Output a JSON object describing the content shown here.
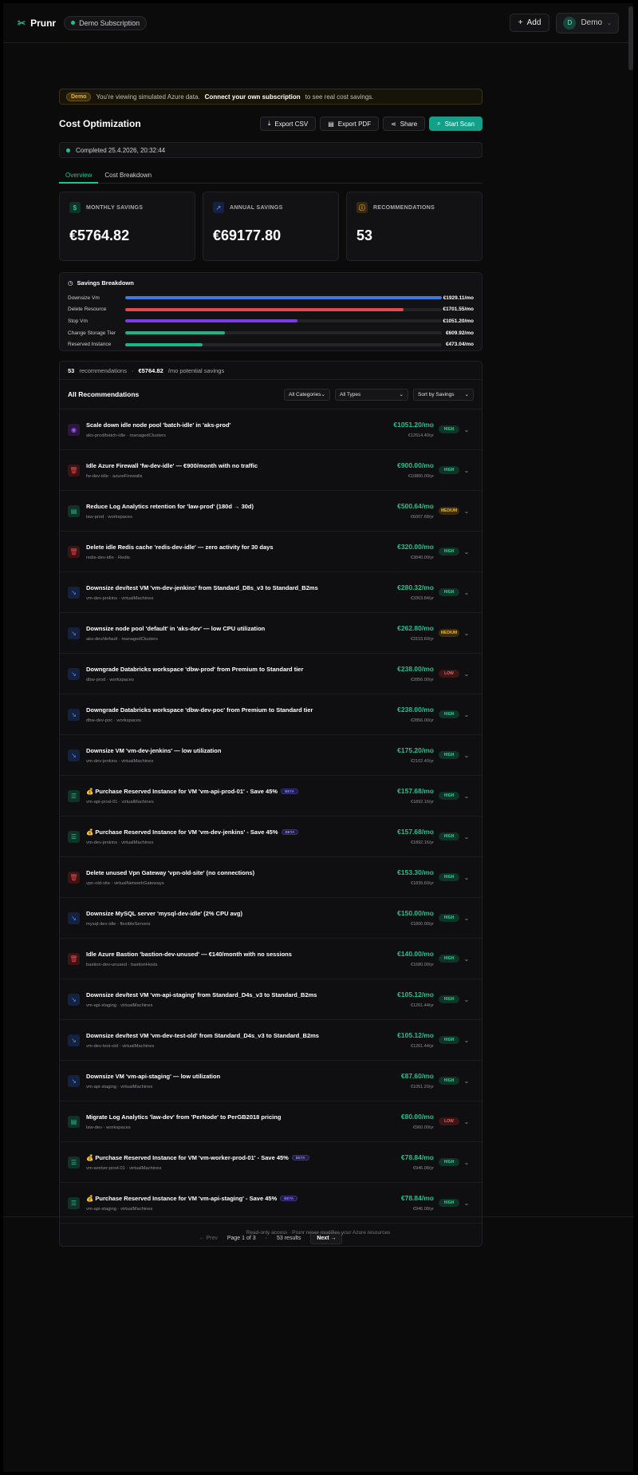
{
  "header": {
    "brand": "Prunr",
    "subscription": "Demo Subscription",
    "add_label": "Add",
    "user_initial": "D",
    "user_label": "Demo"
  },
  "banner": {
    "tag": "Demo",
    "text": "You're viewing simulated Azure data.",
    "link": "Connect your own subscription",
    "suffix": "to see real cost savings."
  },
  "page": {
    "title": "Cost Optimization",
    "actions": {
      "export_csv": "Export CSV",
      "export_pdf": "Export PDF",
      "share": "Share",
      "start_scan": "Start Scan"
    },
    "completed": "Completed 25.4.2026, 20:32:44",
    "tabs": [
      "Overview",
      "Cost Breakdown"
    ]
  },
  "stats": [
    {
      "label": "MONTHLY SAVINGS",
      "value": "€5764.82",
      "icon": "dollar-icon",
      "color": "#22c28a"
    },
    {
      "label": "ANNUAL SAVINGS",
      "value": "€69177.80",
      "icon": "trend-up-icon",
      "color": "#4f7de8"
    },
    {
      "label": "RECOMMENDATIONS",
      "value": "53",
      "icon": "alert-icon",
      "color": "#e79a2f"
    }
  ],
  "breakdown": {
    "title": "Savings Breakdown",
    "rows": [
      {
        "label": "Downsize Vm",
        "amount": "€1929.11/mo",
        "fraction": 1.0,
        "color": "#3b7ae6"
      },
      {
        "label": "Delete Resource",
        "amount": "€1701.55/mo",
        "fraction": 0.88,
        "color": "#e5484d"
      },
      {
        "label": "Stop Vm",
        "amount": "€1051.20/mo",
        "fraction": 0.545,
        "color": "#7c3aed"
      },
      {
        "label": "Change Storage Tier",
        "amount": "€609.92/mo",
        "fraction": 0.316,
        "color": "#1bb482"
      },
      {
        "label": "Reserved Instance",
        "amount": "€473.04/mo",
        "fraction": 0.245,
        "color": "#1bb482"
      }
    ]
  },
  "recommendations": {
    "count": "53",
    "count_label": "recommendations",
    "total": "€5764.82",
    "total_label": "/mo potential savings",
    "title": "All Recommendations",
    "filters": {
      "categories": "All Categories",
      "types": "All Types",
      "sort": "Sort by Savings"
    },
    "items": [
      {
        "title": "Scale down idle node pool 'batch-idle' in 'aks-prod'",
        "sub": "aks-prod/batch-idle · managedClusters",
        "monthly": "€1051.20/mo",
        "yearly": "€12614.40/yr",
        "priority": "HIGH",
        "kind": "stop"
      },
      {
        "title": "Idle Azure Firewall 'fw-dev-idle' — €900/month with no traffic",
        "sub": "fw-dev-idle · azureFirewalls",
        "monthly": "€900.00/mo",
        "yearly": "€10800.00/yr",
        "priority": "HIGH",
        "kind": "delete"
      },
      {
        "title": "Reduce Log Analytics retention for 'law-prod' (180d → 30d)",
        "sub": "law-prod · workspaces",
        "monthly": "€500.64/mo",
        "yearly": "€6007.68/yr",
        "priority": "MEDIUM",
        "kind": "storage"
      },
      {
        "title": "Delete idle Redis cache 'redis-dev-idle' — zero activity for 30 days",
        "sub": "redis-dev-idle · Redis",
        "monthly": "€320.00/mo",
        "yearly": "€3840.00/yr",
        "priority": "HIGH",
        "kind": "delete"
      },
      {
        "title": "Downsize dev/test VM 'vm-dev-jenkins' from Standard_D8s_v3 to Standard_B2ms",
        "sub": "vm-dev-jenkins · virtualMachines",
        "monthly": "€280.32/mo",
        "yearly": "€3363.84/yr",
        "priority": "HIGH",
        "kind": "downsize"
      },
      {
        "title": "Downsize node pool 'default' in 'aks-dev' — low CPU utilization",
        "sub": "aks-dev/default · managedClusters",
        "monthly": "€262.80/mo",
        "yearly": "€3153.60/yr",
        "priority": "MEDIUM",
        "kind": "downsize"
      },
      {
        "title": "Downgrade Databricks workspace 'dbw-prod' from Premium to Standard tier",
        "sub": "dbw-prod · workspaces",
        "monthly": "€238.00/mo",
        "yearly": "€2856.00/yr",
        "priority": "LOW",
        "kind": "downsize"
      },
      {
        "title": "Downgrade Databricks workspace 'dbw-dev-poc' from Premium to Standard tier",
        "sub": "dbw-dev-poc · workspaces",
        "monthly": "€238.00/mo",
        "yearly": "€2856.00/yr",
        "priority": "HIGH",
        "kind": "downsize"
      },
      {
        "title": "Downsize VM 'vm-dev-jenkins' — low utilization",
        "sub": "vm-dev-jenkins · virtualMachines",
        "monthly": "€175.20/mo",
        "yearly": "€2102.40/yr",
        "priority": "HIGH",
        "kind": "downsize"
      },
      {
        "title": "💰 Purchase Reserved Instance for VM 'vm-api-prod-01' - Save 45%",
        "sub": "vm-api-prod-01 · virtualMachines",
        "monthly": "€157.68/mo",
        "yearly": "€1892.16/yr",
        "priority": "HIGH",
        "kind": "reserved",
        "beta": "BETA"
      },
      {
        "title": "💰 Purchase Reserved Instance for VM 'vm-dev-jenkins' - Save 45%",
        "sub": "vm-dev-jenkins · virtualMachines",
        "monthly": "€157.68/mo",
        "yearly": "€1892.16/yr",
        "priority": "HIGH",
        "kind": "reserved",
        "beta": "BETA"
      },
      {
        "title": "Delete unused Vpn Gateway 'vpn-old-site' (no connections)",
        "sub": "vpn-old-site · virtualNetworkGateways",
        "monthly": "€153.30/mo",
        "yearly": "€1839.60/yr",
        "priority": "HIGH",
        "kind": "delete"
      },
      {
        "title": "Downsize MySQL server 'mysql-dev-idle' (2% CPU avg)",
        "sub": "mysql-dev-idle · flexibleServers",
        "monthly": "€150.00/mo",
        "yearly": "€1800.00/yr",
        "priority": "HIGH",
        "kind": "downsize"
      },
      {
        "title": "Idle Azure Bastion 'bastion-dev-unused' — €140/month with no sessions",
        "sub": "bastion-dev-unused · bastionHosts",
        "monthly": "€140.00/mo",
        "yearly": "€1680.00/yr",
        "priority": "HIGH",
        "kind": "delete"
      },
      {
        "title": "Downsize dev/test VM 'vm-api-staging' from Standard_D4s_v3 to Standard_B2ms",
        "sub": "vm-api-staging · virtualMachines",
        "monthly": "€105.12/mo",
        "yearly": "€1261.44/yr",
        "priority": "HIGH",
        "kind": "downsize"
      },
      {
        "title": "Downsize dev/test VM 'vm-dev-test-old' from Standard_D4s_v3 to Standard_B2ms",
        "sub": "vm-dev-test-old · virtualMachines",
        "monthly": "€105.12/mo",
        "yearly": "€1261.44/yr",
        "priority": "HIGH",
        "kind": "downsize"
      },
      {
        "title": "Downsize VM 'vm-api-staging' — low utilization",
        "sub": "vm-api-staging · virtualMachines",
        "monthly": "€87.60/mo",
        "yearly": "€1051.20/yr",
        "priority": "HIGH",
        "kind": "downsize"
      },
      {
        "title": "Migrate Log Analytics 'law-dev' from 'PerNode' to PerGB2018 pricing",
        "sub": "law-dev · workspaces",
        "monthly": "€80.00/mo",
        "yearly": "€960.00/yr",
        "priority": "LOW",
        "kind": "storage"
      },
      {
        "title": "💰 Purchase Reserved Instance for VM 'vm-worker-prod-01' - Save 45%",
        "sub": "vm-worker-prod-01 · virtualMachines",
        "monthly": "€78.84/mo",
        "yearly": "€946.08/yr",
        "priority": "HIGH",
        "kind": "reserved",
        "beta": "BETA"
      },
      {
        "title": "💰 Purchase Reserved Instance for VM 'vm-api-staging' - Save 45%",
        "sub": "vm-api-staging · virtualMachines",
        "monthly": "€78.84/mo",
        "yearly": "€946.08/yr",
        "priority": "HIGH",
        "kind": "reserved",
        "beta": "BETA"
      }
    ],
    "pager": {
      "prev": "← Prev",
      "page": "Page 1 of 3",
      "results": "53 results",
      "next": "Next →"
    }
  },
  "footer": "Read-only access · Prunr never modifies your Azure resources",
  "kinds": {
    "stop": {
      "icon": "◉",
      "fg": "#a855f7",
      "bg": "#2a1640"
    },
    "delete": {
      "icon": "🗑",
      "fg": "#ef4444",
      "bg": "#3a1416"
    },
    "storage": {
      "icon": "▤",
      "fg": "#22c28a",
      "bg": "#0f3327"
    },
    "downsize": {
      "icon": "↘",
      "fg": "#4f8ff0",
      "bg": "#14223f"
    },
    "reserved": {
      "icon": "☰",
      "fg": "#22c28a",
      "bg": "#0f3327"
    }
  }
}
